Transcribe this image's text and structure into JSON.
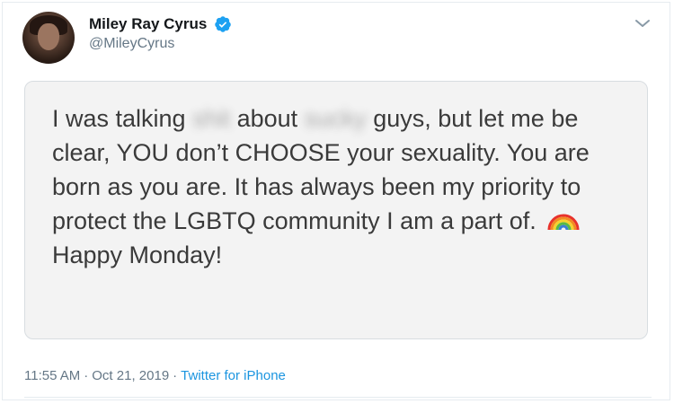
{
  "tweet": {
    "author": {
      "display_name": "Miley Ray Cyrus",
      "handle": "@MileyCyrus",
      "verified": true,
      "avatar_icon": "profile-photo"
    },
    "menu_icon": "chevron-down-icon",
    "image_text": {
      "part1": "I was talking ",
      "blurred1": "shit",
      "part2": " about ",
      "blurred2": "sucky",
      "part3": " guys, but let me be clear, YOU don’t CHOOSE your sexuality. You are born as you are. It has always been my priority to protect the LGBTQ community I am a part of. ",
      "emoji": "rainbow-emoji",
      "part4": "Happy Monday!"
    },
    "footer": {
      "time": "11:55 AM",
      "separator": "·",
      "date": "Oct 21, 2019",
      "source": "Twitter for iPhone"
    }
  },
  "colors": {
    "link": "#1b95e0",
    "secondary_text": "#657786",
    "verified_badge": "#1da1f2",
    "note_background": "#f3f3f3"
  }
}
